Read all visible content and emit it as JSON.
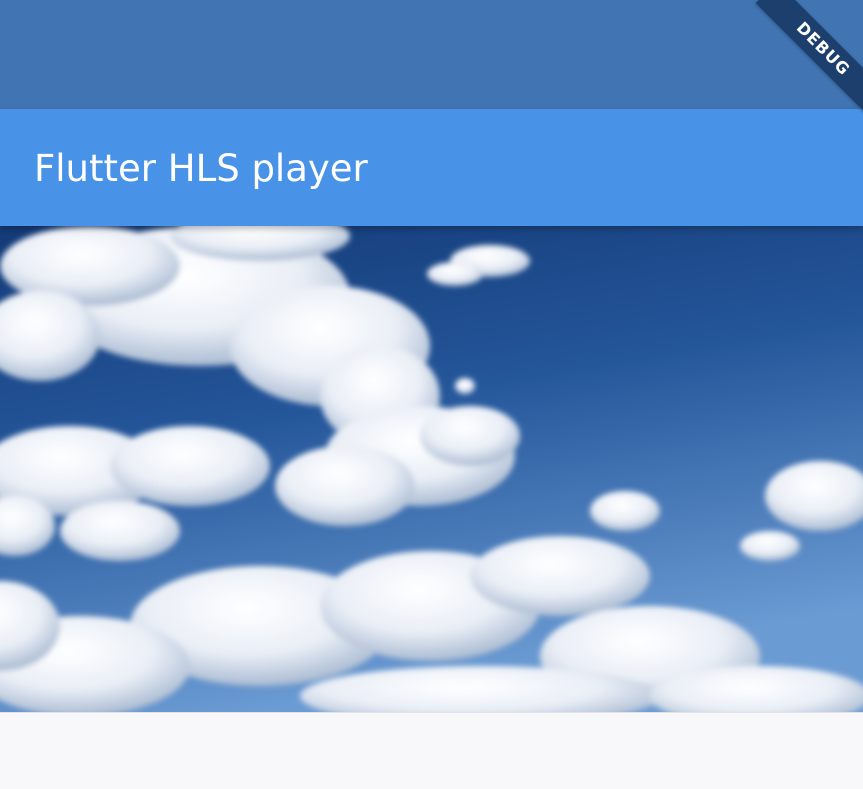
{
  "app_bar": {
    "title": "Flutter HLS player"
  },
  "debug_banner": {
    "label": "DEBUG"
  },
  "colors": {
    "status_bar": "#4174b2",
    "app_bar": "#4893e8",
    "sky_top": "#143a77",
    "sky_bottom": "#6b9bd3",
    "body_background": "#f8f8fa",
    "debug_ribbon": "#1d3f6e"
  }
}
